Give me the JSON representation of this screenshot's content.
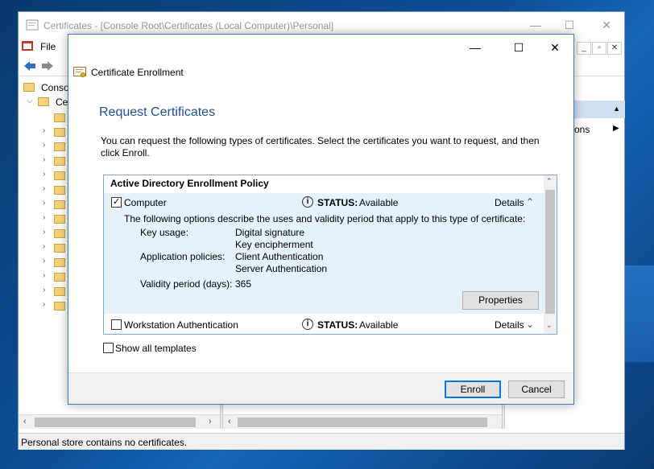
{
  "mmc": {
    "title": "Certificates - [Console Root\\Certificates (Local Computer)\\Personal]",
    "menu_file": "File",
    "tree_console": "Conso",
    "tree_certs": "Ce",
    "actions_label": "ons",
    "status": "Personal store contains no certificates.",
    "inner_min": "_",
    "inner_restore": "▫",
    "inner_close": "✕"
  },
  "dialog": {
    "header": "Certificate Enrollment",
    "heading": "Request Certificates",
    "description": "You can request the following types of certificates. Select the certificates you want to request, and then click Enroll.",
    "policy_name": "Active Directory Enrollment Policy",
    "items": [
      {
        "name": "Computer",
        "checked": true,
        "status_label": "STATUS:",
        "status_value": "Available",
        "details_label": "Details",
        "expanded": true,
        "detail_intro": "The following options describe the uses and validity period that apply to this type of certificate:",
        "key_usage_label": "Key usage:",
        "key_usage_1": "Digital signature",
        "key_usage_2": "Key encipherment",
        "app_policies_label": "Application policies:",
        "app_policy_1": "Client Authentication",
        "app_policy_2": "Server Authentication",
        "validity_label": "Validity period (days):",
        "validity_value": "365",
        "properties_label": "Properties"
      },
      {
        "name": "Workstation Authentication",
        "checked": false,
        "status_label": "STATUS:",
        "status_value": "Available",
        "details_label": "Details",
        "expanded": false
      }
    ],
    "show_all_label": "Show all templates",
    "enroll_label": "Enroll",
    "cancel_label": "Cancel"
  },
  "colors": {
    "accent": "#0078d7",
    "heading": "#1e4f92",
    "selection": "#e5f1fb"
  }
}
